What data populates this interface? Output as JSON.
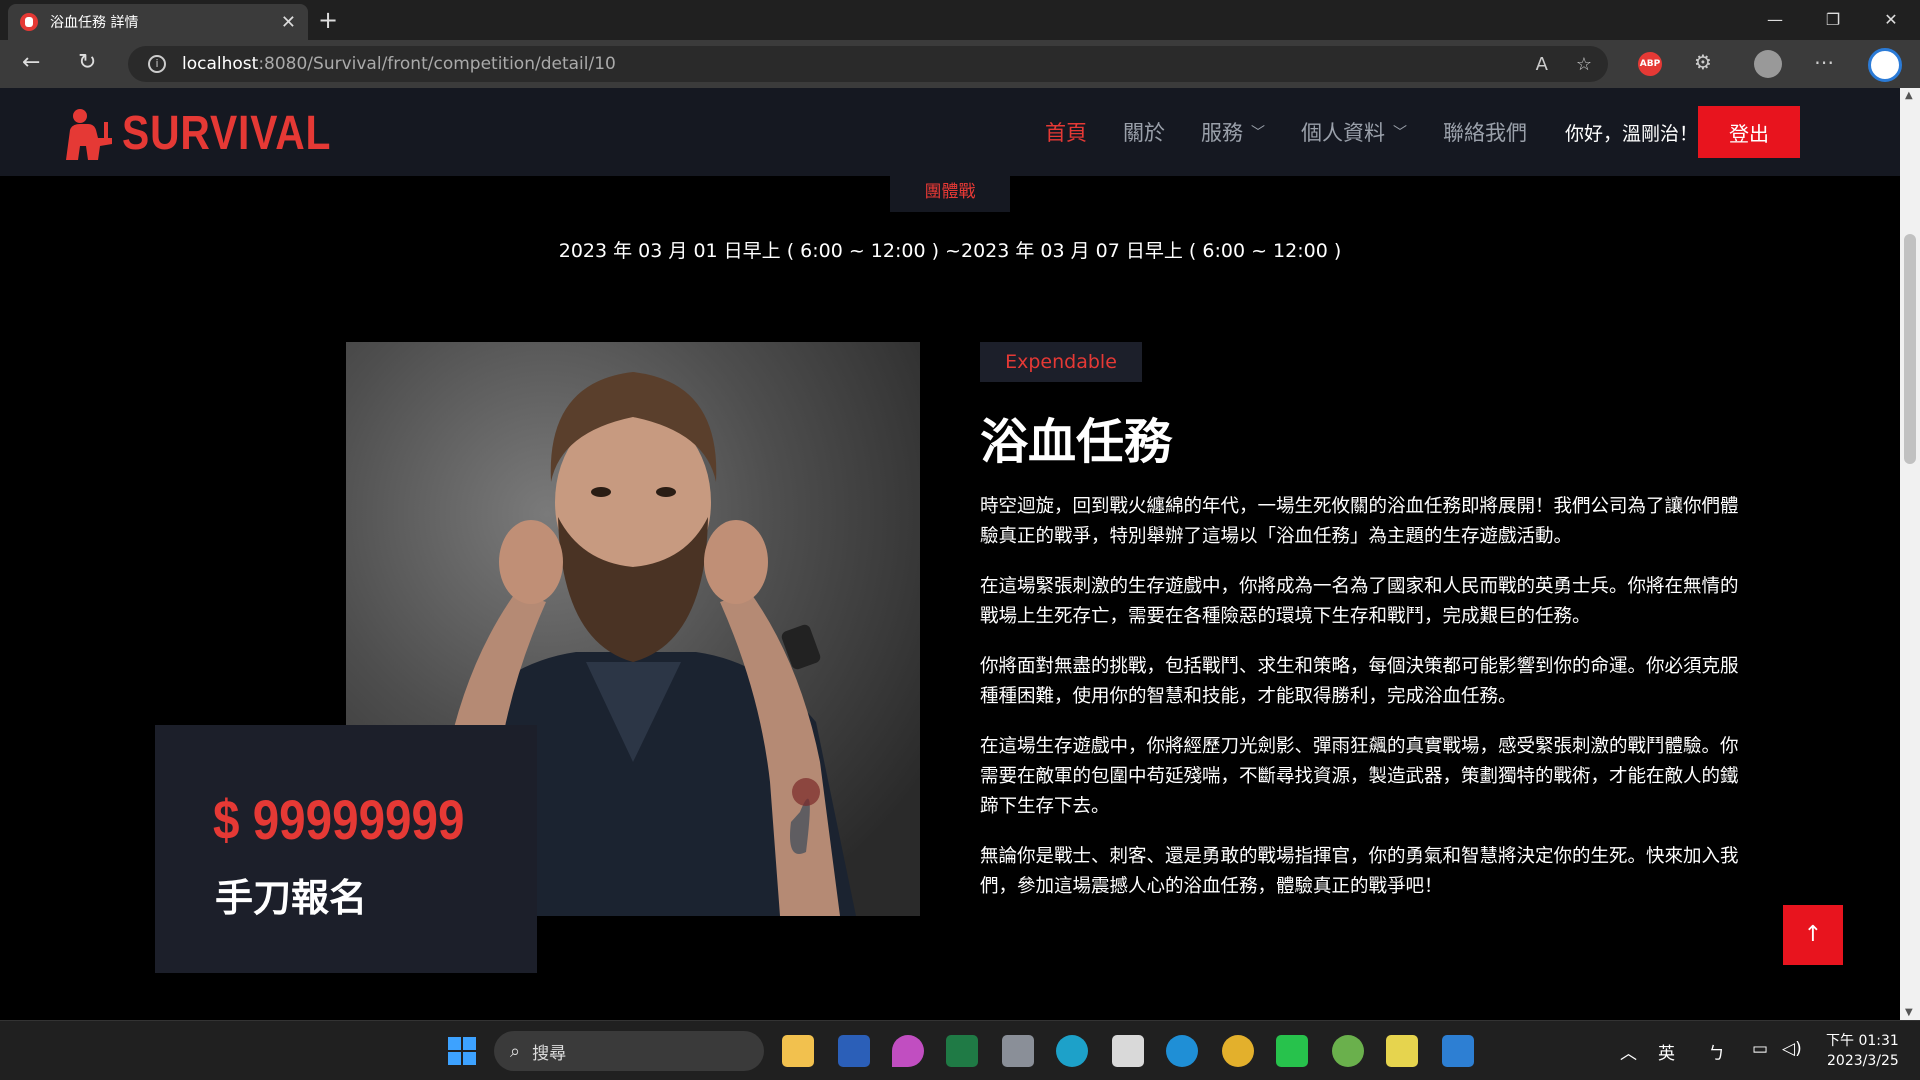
{
  "browser": {
    "tab_title": "浴血任務 詳情",
    "url_host": "localhost",
    "url_path": ":8080/Survival/front/competition/detail/10"
  },
  "header": {
    "logo_text": "SURVIVAL",
    "nav": [
      {
        "label": "首頁",
        "active": true
      },
      {
        "label": "關於"
      },
      {
        "label": "服務",
        "dropdown": true
      },
      {
        "label": "個人資料",
        "dropdown": true
      },
      {
        "label": "聯絡我們"
      }
    ],
    "greeting": "你好，溫剛治！",
    "logout_label": "登出"
  },
  "competition": {
    "category": "團體戰",
    "date_range": "2023 年 03 月 01 日早上 ( 6:00 ~ 12:00 ) ~2023 年 03 月 07 日早上 ( 6:00 ~ 12:00 )",
    "badge": "Expendable",
    "title": "浴血任務",
    "price": "$ 99999999",
    "signup_label": "手刀報名",
    "paragraphs": [
      "時空迴旋，回到戰火纏綿的年代，一場生死攸關的浴血任務即將展開！我們公司為了讓你們體驗真正的戰爭，特別舉辦了這場以「浴血任務」為主題的生存遊戲活動。",
      "在這場緊張刺激的生存遊戲中，你將成為一名為了國家和人民而戰的英勇士兵。你將在無情的戰場上生死存亡，需要在各種險惡的環境下生存和戰鬥，完成艱巨的任務。",
      "你將面對無盡的挑戰，包括戰鬥、求生和策略，每個決策都可能影響到你的命運。你必須克服種種困難，使用你的智慧和技能，才能取得勝利，完成浴血任務。",
      "在這場生存遊戲中，你將經歷刀光劍影、彈雨狂飆的真實戰場，感受緊張刺激的戰鬥體驗。你需要在敵軍的包圍中苟延殘喘，不斷尋找資源，製造武器，策劃獨特的戰術，才能在敵人的鐵蹄下生存下去。",
      "無論你是戰士、刺客、還是勇敢的戰場指揮官，你的勇氣和智慧將決定你的生死。快來加入我們，參加這場震撼人心的浴血任務，體驗真正的戰爭吧！"
    ]
  },
  "taskbar": {
    "search_label": "搜尋",
    "ime_lang": "英",
    "clock_time": "下午 01:31",
    "clock_date": "2023/3/25"
  },
  "colors": {
    "accent": "#e53935",
    "header_bg": "#151821",
    "card_bg": "#1c1f2a"
  }
}
